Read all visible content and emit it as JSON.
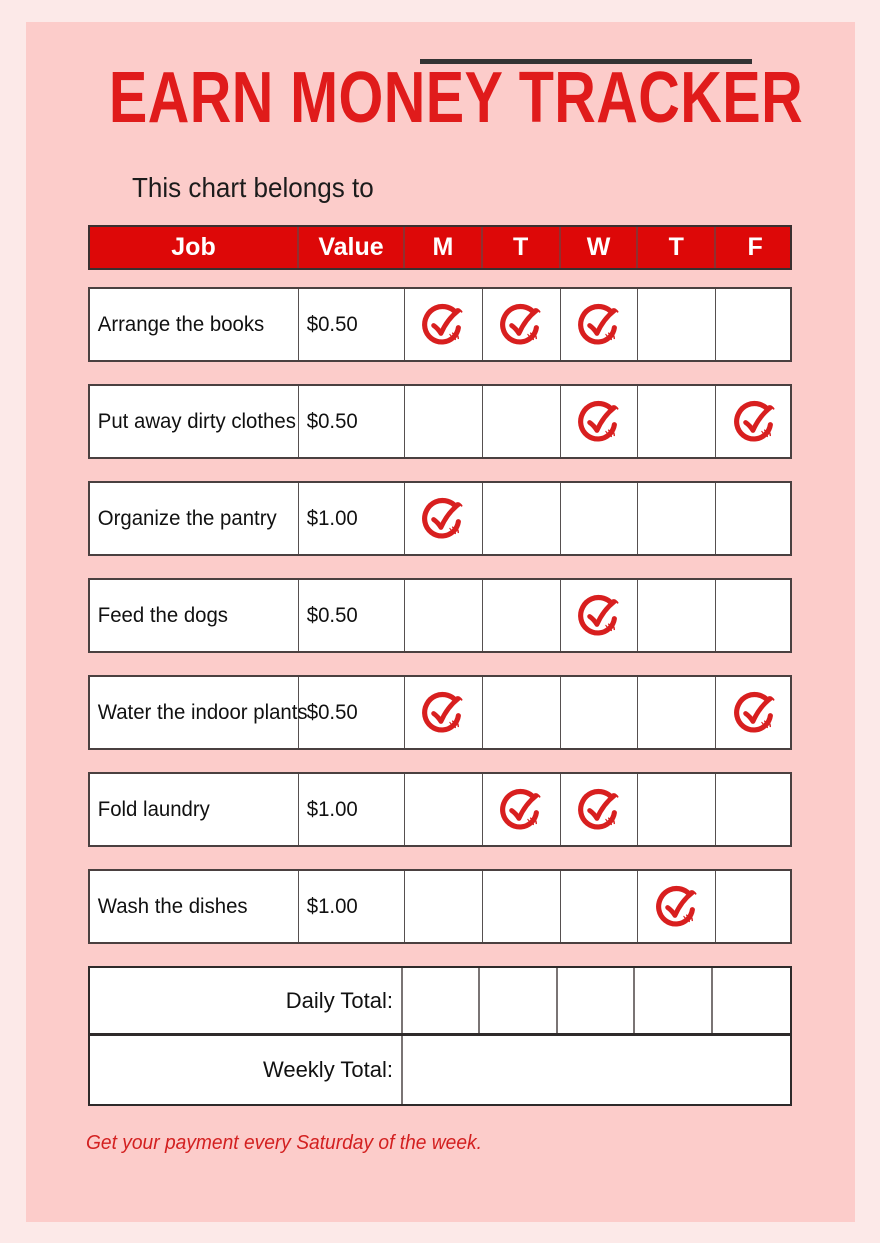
{
  "document": {
    "title": "EARN MONEY TRACKER",
    "belongs_to_label": "This chart belongs to",
    "belongs_to_value": "",
    "footer_note": "Get your payment every Saturday of the week.",
    "colors": {
      "page_background": "#fce9e8",
      "panel_background": "#fcccca",
      "title_red": "#e01b1b",
      "header_red": "#dd0808",
      "check_red": "#d81f1f",
      "cell_background": "#ffffff",
      "border_dark": "#3a3030",
      "text_dark": "#111111",
      "footer_red": "#d32020"
    }
  },
  "table": {
    "columns": [
      {
        "key": "job",
        "label": "Job"
      },
      {
        "key": "value",
        "label": "Value"
      },
      {
        "key": "mon",
        "label": "M"
      },
      {
        "key": "tue",
        "label": "T"
      },
      {
        "key": "wed",
        "label": "W"
      },
      {
        "key": "thu",
        "label": "T"
      },
      {
        "key": "fri",
        "label": "F"
      }
    ],
    "rows": [
      {
        "job": "Arrange the books",
        "value": "$0.50",
        "checks": [
          true,
          true,
          true,
          false,
          false
        ]
      },
      {
        "job": "Put away dirty clothes",
        "value": "$0.50",
        "checks": [
          false,
          false,
          true,
          false,
          true
        ]
      },
      {
        "job": "Organize the pantry",
        "value": "$1.00",
        "checks": [
          true,
          false,
          false,
          false,
          false
        ]
      },
      {
        "job": "Feed the dogs",
        "value": "$0.50",
        "checks": [
          false,
          false,
          true,
          false,
          false
        ]
      },
      {
        "job": "Water the indoor plants",
        "value": "$0.50",
        "checks": [
          true,
          false,
          false,
          false,
          true
        ]
      },
      {
        "job": "Fold laundry",
        "value": "$1.00",
        "checks": [
          false,
          true,
          true,
          false,
          false
        ]
      },
      {
        "job": "Wash the dishes",
        "value": "$1.00",
        "checks": [
          false,
          false,
          false,
          true,
          false
        ]
      }
    ],
    "totals": {
      "daily_label": "Daily Total:",
      "daily_values": [
        "",
        "",
        "",
        "",
        ""
      ],
      "weekly_label": "Weekly Total:",
      "weekly_value": ""
    }
  },
  "icons": {
    "check": "hand-drawn-check-circle-icon"
  }
}
